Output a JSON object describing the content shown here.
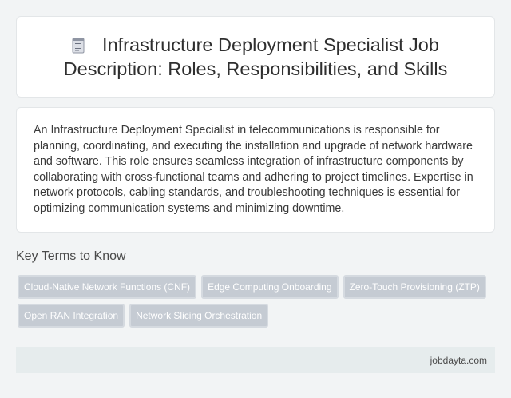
{
  "header": {
    "icon": "document-icon",
    "title": "Infrastructure Deployment Specialist Job Description: Roles, Responsibilities, and Skills"
  },
  "description": {
    "text": "An Infrastructure Deployment Specialist in telecommunications is responsible for planning, coordinating, and executing the installation and upgrade of network hardware and software. This role ensures seamless integration of infrastructure components by collaborating with cross-functional teams and adhering to project timelines. Expertise in network protocols, cabling standards, and troubleshooting techniques is essential for optimizing communication systems and minimizing downtime."
  },
  "key_terms": {
    "heading": "Key Terms to Know",
    "items": [
      "Cloud-Native Network Functions (CNF)",
      "Edge Computing Onboarding",
      "Zero-Touch Provisioning (ZTP)",
      "Open RAN Integration",
      "Network Slicing Orchestration"
    ]
  },
  "footer": {
    "site": "jobdayta.com"
  },
  "colors": {
    "tag_background": "#c5cbd3",
    "footer_background": "#e6eced",
    "page_background": "#f2f4f5"
  }
}
